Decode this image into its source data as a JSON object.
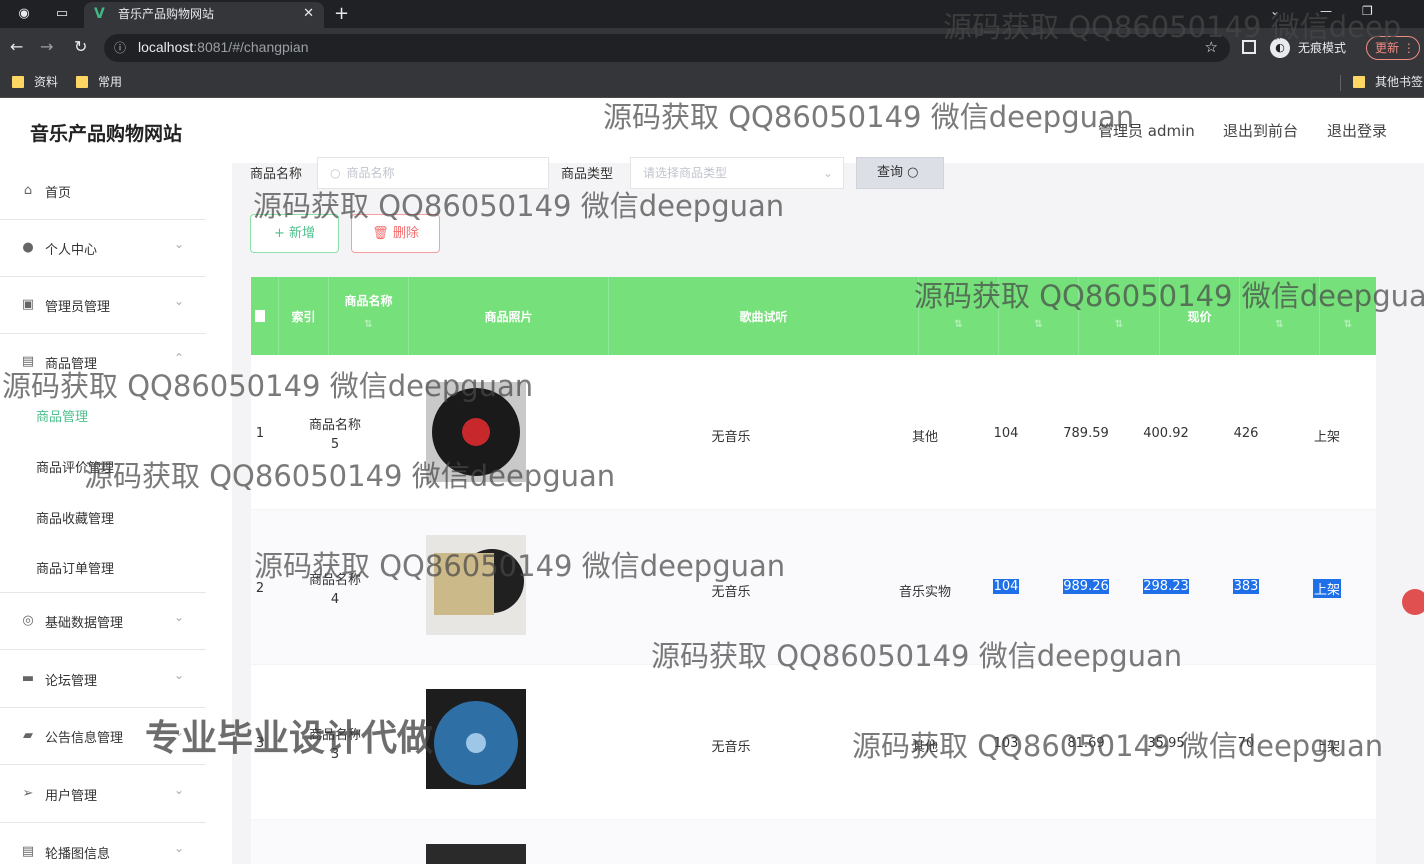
{
  "browser": {
    "tab_title": "音乐产品购物网站",
    "url_host": "localhost",
    "url_rest": ":8081/#/changpian",
    "incognito_label": "无痕模式",
    "update_label": "更新",
    "bookmarks": [
      "资料",
      "常用"
    ],
    "other_bookmarks": "其他书签"
  },
  "app": {
    "title": "音乐产品购物网站",
    "header_links": [
      "管理员 admin",
      "退出到前台",
      "退出登录"
    ]
  },
  "sidebar": {
    "items": [
      {
        "label": "首页",
        "icon": "home-icon"
      },
      {
        "label": "个人中心",
        "icon": "user-icon"
      },
      {
        "label": "管理员管理",
        "icon": "admin-icon"
      },
      {
        "label": "商品管理",
        "icon": "goods-icon"
      },
      {
        "label": "基础数据管理",
        "icon": "data-icon"
      },
      {
        "label": "论坛管理",
        "icon": "forum-icon"
      },
      {
        "label": "公告信息管理",
        "icon": "notice-icon"
      },
      {
        "label": "用户管理",
        "icon": "users-icon"
      },
      {
        "label": "轮播图信息",
        "icon": "carousel-icon"
      }
    ],
    "submenu": [
      "商品管理",
      "商品评价管理",
      "商品收藏管理",
      "商品订单管理"
    ]
  },
  "search": {
    "name_label": "商品名称",
    "name_placeholder": "商品名称",
    "type_label": "商品类型",
    "type_placeholder": "请选择商品类型",
    "query_label": "查询"
  },
  "actions": {
    "add": "新增",
    "delete": "删除"
  },
  "table": {
    "headers": [
      "索引",
      "商品名称",
      "商品照片",
      "歌曲试听",
      "现价"
    ],
    "rows": [
      {
        "index": "1",
        "name": "商品名称",
        "name2": "5",
        "audio": "无音乐",
        "type": "其他",
        "stock": "104",
        "orig": "789.59",
        "price": "400.92",
        "clicks": "426",
        "status": "上架"
      },
      {
        "index": "2",
        "name": "商品名称",
        "name2": "4",
        "audio": "无音乐",
        "type": "音乐实物",
        "stock": "104",
        "orig": "989.26",
        "price": "298.23",
        "clicks": "383",
        "status": "上架"
      },
      {
        "index": "3",
        "name": "商品名称",
        "name2": "3",
        "audio": "无音乐",
        "type": "其他",
        "stock": "103",
        "orig": "81.69",
        "price": "35.95",
        "clicks": "70",
        "status": "上架"
      }
    ]
  },
  "watermarks": {
    "main": "源码获取 QQ86050149 微信deepguan",
    "top_right": "源码获取 QQ86050149 微信deep",
    "header_right": "源码获取 QQ86050149 微信deepgua",
    "bold": "专业毕业设计代做"
  }
}
